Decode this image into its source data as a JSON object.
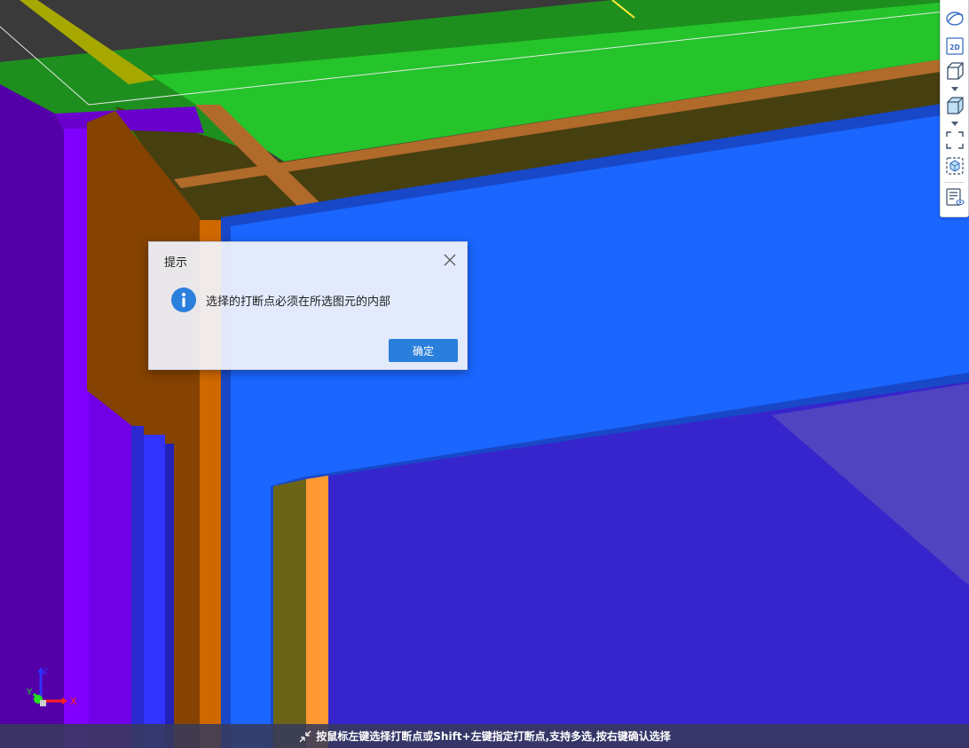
{
  "toolbar": {
    "items": [
      {
        "name": "orbit-icon",
        "label": ""
      },
      {
        "name": "view-2d-icon",
        "label": "2D"
      },
      {
        "name": "wireframe-cube-icon",
        "label": ""
      },
      {
        "name": "solid-cube-icon",
        "label": ""
      },
      {
        "name": "zoom-extents-icon",
        "label": ""
      },
      {
        "name": "zoom-selection-icon",
        "label": ""
      },
      {
        "name": "display-settings-icon",
        "label": ""
      }
    ]
  },
  "dialog": {
    "title": "提示",
    "message": "选择的打断点必须在所选图元的内部",
    "ok_label": "确定",
    "icon": "info-icon"
  },
  "axes": {
    "x_label": "X",
    "y_label": "Y",
    "z_label": "Z"
  },
  "status": {
    "text": "按鼠标左键选择打断点或Shift+左键指定打断点,支持多选,按右键确认选择"
  },
  "colors": {
    "accent": "#2b7fdc",
    "green_slab": "#24c42a",
    "blue_wall": "#1a66ff",
    "purple_column": "#8000ff"
  }
}
